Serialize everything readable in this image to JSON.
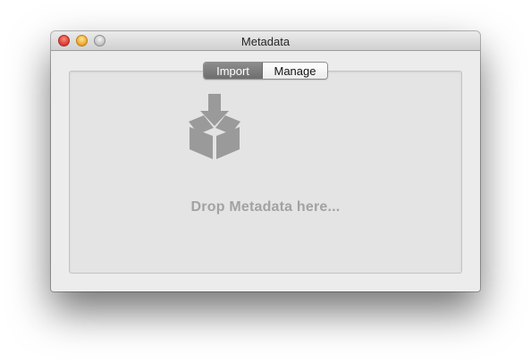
{
  "window": {
    "title": "Metadata"
  },
  "segmented_control": {
    "options": [
      {
        "label": "Import",
        "selected": true
      },
      {
        "label": "Manage",
        "selected": false
      }
    ]
  },
  "drop_zone": {
    "icon": "box-download-icon",
    "text": "Drop Metadata here..."
  },
  "colors": {
    "window_bg": "#ececec",
    "drop_zone_bg": "#e4e4e4",
    "icon_gray": "#9a9a9a",
    "selected_segment": "#7d7d7d"
  }
}
